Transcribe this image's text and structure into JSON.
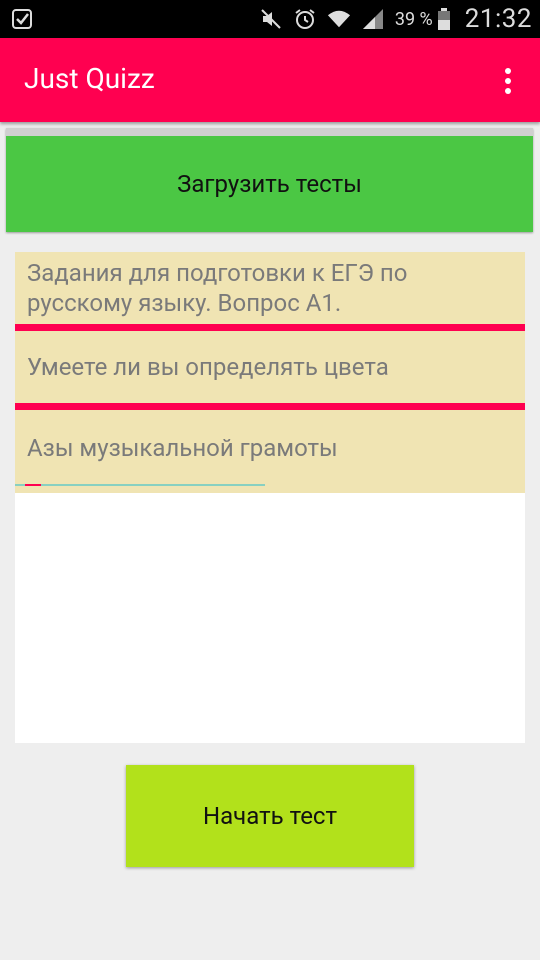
{
  "status_bar": {
    "battery_percent": "39 %",
    "time": "21:32",
    "icons": [
      "checkbox-icon",
      "mute-icon",
      "alarm-icon",
      "wifi-icon",
      "signal-icon",
      "battery-icon"
    ]
  },
  "app_bar": {
    "title": "Just Quizz",
    "menu_icon": "overflow-menu-icon"
  },
  "load_button": {
    "label": "Загрузить тесты"
  },
  "quiz_list": {
    "items": [
      {
        "label": "Задания для подготовки к ЕГЭ по русскому языку. Вопрос А1."
      },
      {
        "label": "Умеете ли вы определять цвета"
      },
      {
        "label": "Азы музыкальной грамоты"
      }
    ]
  },
  "start_button": {
    "label": "Начать тест"
  },
  "colors": {
    "accent": "#ff0050",
    "load_button": "#4bc744",
    "start_button": "#b2e11b",
    "list_item_bg": "#f0e4b3",
    "background": "#eeeeee"
  }
}
